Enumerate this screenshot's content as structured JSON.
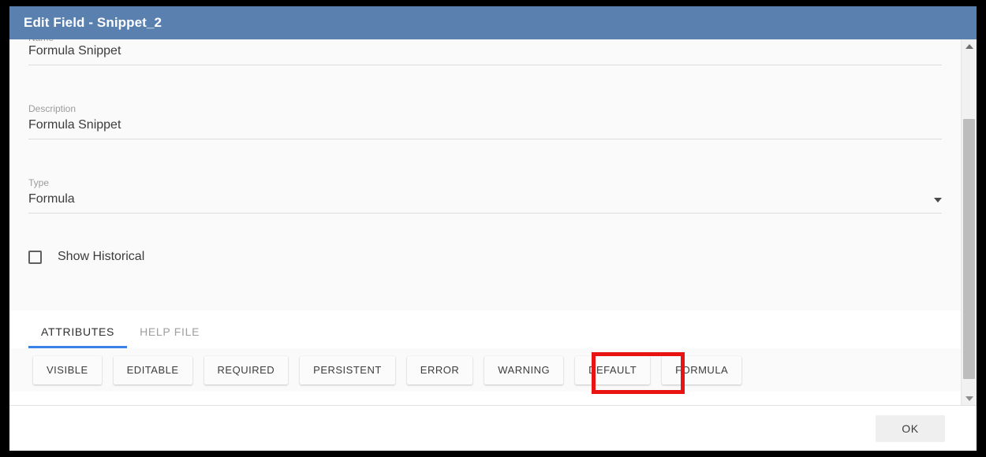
{
  "window": {
    "title": "Edit Field - Snippet_2"
  },
  "form": {
    "fields": [
      {
        "label": "Name",
        "value": "Formula Snippet",
        "type": "text"
      },
      {
        "label": "Description",
        "value": "Formula Snippet",
        "type": "text"
      },
      {
        "label": "Type",
        "value": "Formula",
        "type": "select"
      }
    ],
    "checkbox": {
      "label": "Show Historical",
      "checked": false
    }
  },
  "tabs": [
    {
      "label": "ATTRIBUTES",
      "active": true
    },
    {
      "label": "HELP FILE",
      "active": false
    }
  ],
  "attributes": [
    {
      "label": "VISIBLE"
    },
    {
      "label": "EDITABLE"
    },
    {
      "label": "REQUIRED"
    },
    {
      "label": "PERSISTENT"
    },
    {
      "label": "ERROR"
    },
    {
      "label": "WARNING"
    },
    {
      "label": "DEFAULT"
    },
    {
      "label": "FORMULA"
    }
  ],
  "footer": {
    "ok_label": "OK"
  },
  "scrollbar": {
    "up_icon": "triangle-up-icon",
    "down_icon": "triangle-down-icon"
  },
  "annotation": {
    "target": "FORMULA",
    "color": "#e81313"
  },
  "colors": {
    "titlebar": "#5a80b0",
    "tab_active_underline": "#3b82e8",
    "panel_background": "#fafafa",
    "highlight": "#e81313"
  }
}
